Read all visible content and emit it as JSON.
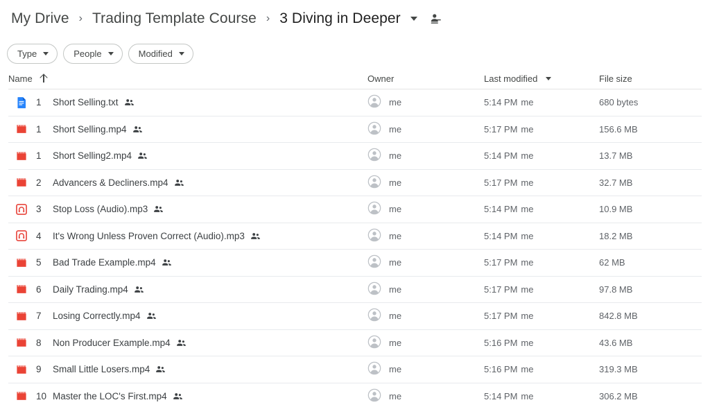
{
  "breadcrumb": {
    "items": [
      {
        "label": "My Drive",
        "current": false
      },
      {
        "label": "Trading Template Course",
        "current": false
      },
      {
        "label": "3 Diving in Deeper",
        "current": true
      }
    ],
    "separator": "›",
    "share_icon": "folder-shared-icon",
    "caret_icon": "chevron-down-icon"
  },
  "filters": [
    {
      "label": "Type",
      "icon": "chevron-down-icon"
    },
    {
      "label": "People",
      "icon": "chevron-down-icon"
    },
    {
      "label": "Modified",
      "icon": "chevron-down-icon"
    }
  ],
  "columns": {
    "name": "Name",
    "name_sort_icon": "sort-ascending-arrow-icon",
    "owner": "Owner",
    "modified": "Last modified",
    "modified_sort_icon": "chevron-down-icon",
    "size": "File size"
  },
  "colors": {
    "doc_blue": "#2684FC",
    "video_red": "#EA4335",
    "audio_red": "#E8453C",
    "text_primary": "#3c4043",
    "text_secondary": "#5f6368",
    "divider": "#e8eaed"
  },
  "rows": [
    {
      "index": "1",
      "name": "Short Selling.txt",
      "icon": "text-document-icon",
      "shared": true,
      "owner": "me",
      "modified_time": "5:14 PM",
      "modified_by": "me",
      "size": "680 bytes"
    },
    {
      "index": "1",
      "name": "Short Selling.mp4",
      "icon": "video-file-icon",
      "shared": true,
      "owner": "me",
      "modified_time": "5:17 PM",
      "modified_by": "me",
      "size": "156.6 MB"
    },
    {
      "index": "1",
      "name": "Short Selling2.mp4",
      "icon": "video-file-icon",
      "shared": true,
      "owner": "me",
      "modified_time": "5:14 PM",
      "modified_by": "me",
      "size": "13.7 MB"
    },
    {
      "index": "2",
      "name": "Advancers & Decliners.mp4",
      "icon": "video-file-icon",
      "shared": true,
      "owner": "me",
      "modified_time": "5:17 PM",
      "modified_by": "me",
      "size": "32.7 MB"
    },
    {
      "index": "3",
      "name": "Stop Loss (Audio).mp3",
      "icon": "audio-file-icon",
      "shared": true,
      "owner": "me",
      "modified_time": "5:14 PM",
      "modified_by": "me",
      "size": "10.9 MB"
    },
    {
      "index": "4",
      "name": "It's Wrong Unless Proven Correct (Audio).mp3",
      "icon": "audio-file-icon",
      "shared": true,
      "owner": "me",
      "modified_time": "5:14 PM",
      "modified_by": "me",
      "size": "18.2 MB"
    },
    {
      "index": "5",
      "name": "Bad Trade Example.mp4",
      "icon": "video-file-icon",
      "shared": true,
      "owner": "me",
      "modified_time": "5:17 PM",
      "modified_by": "me",
      "size": "62 MB"
    },
    {
      "index": "6",
      "name": "Daily Trading.mp4",
      "icon": "video-file-icon",
      "shared": true,
      "owner": "me",
      "modified_time": "5:17 PM",
      "modified_by": "me",
      "size": "97.8 MB"
    },
    {
      "index": "7",
      "name": "Losing Correctly.mp4",
      "icon": "video-file-icon",
      "shared": true,
      "owner": "me",
      "modified_time": "5:17 PM",
      "modified_by": "me",
      "size": "842.8 MB"
    },
    {
      "index": "8",
      "name": "Non Producer Example.mp4",
      "icon": "video-file-icon",
      "shared": true,
      "owner": "me",
      "modified_time": "5:16 PM",
      "modified_by": "me",
      "size": "43.6 MB"
    },
    {
      "index": "9",
      "name": "Small Little Losers.mp4",
      "icon": "video-file-icon",
      "shared": true,
      "owner": "me",
      "modified_time": "5:16 PM",
      "modified_by": "me",
      "size": "319.3 MB"
    },
    {
      "index": "10",
      "name": "Master the LOC's First.mp4",
      "icon": "video-file-icon",
      "shared": true,
      "owner": "me",
      "modified_time": "5:14 PM",
      "modified_by": "me",
      "size": "306.2 MB"
    }
  ]
}
